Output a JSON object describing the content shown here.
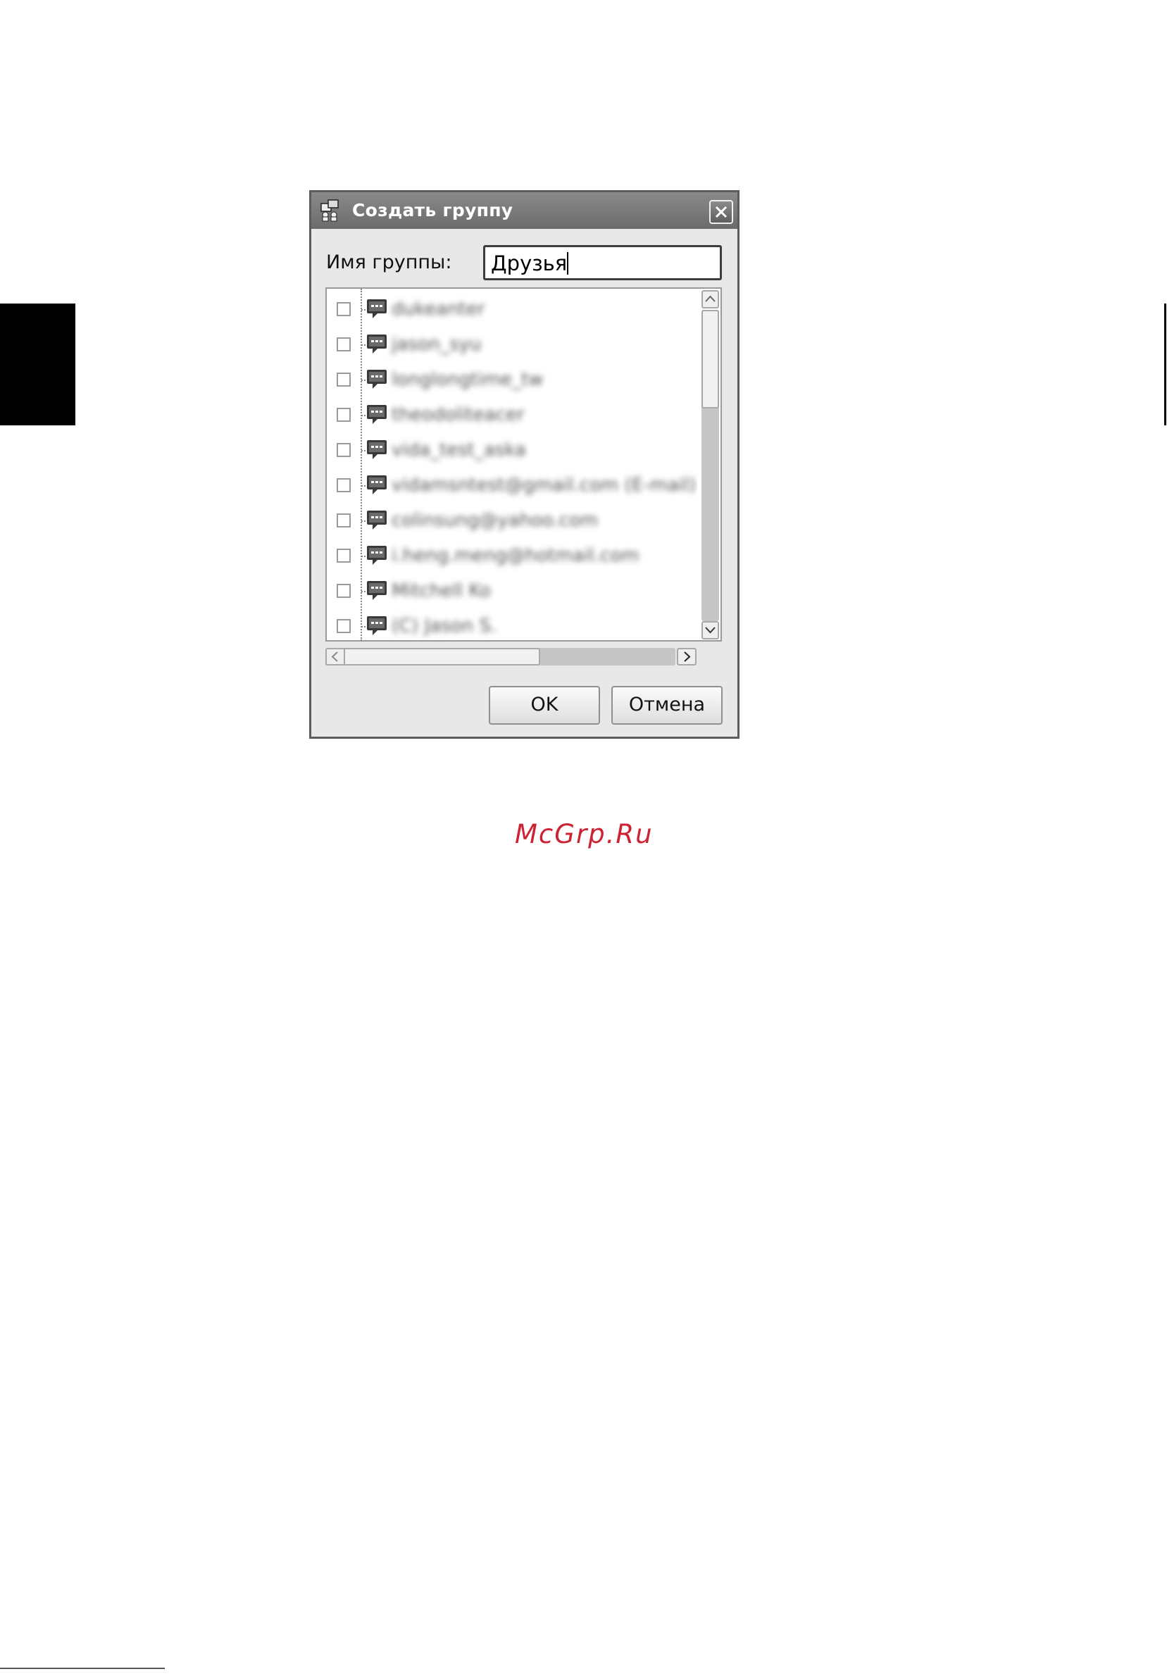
{
  "dialog": {
    "title": "Создать группу",
    "group_name_label": "Имя группы:",
    "group_name_value": "Друзья",
    "contacts": [
      "dukeanter",
      "jason_syu",
      "longlongtime_tw",
      "theodoliteacer",
      "vida_test_aska",
      "vidamsntest@gmail.com (E-mail)",
      "colinsung@yahoo.com",
      "i.heng.meng@hotmail.com",
      "Mitchell Ko",
      "(C) Jason S."
    ],
    "ok_label": "OK",
    "cancel_label": "Отмена"
  },
  "watermark": "McGrp.Ru",
  "colors": {
    "titlebar": "#7a7a7a",
    "watermark": "#cc2233",
    "dialog_bg": "#e8e8e8"
  },
  "icons": [
    "app-icon",
    "close-icon",
    "chat-bubble-icon",
    "arrow-up-icon",
    "arrow-down-icon",
    "arrow-left-icon",
    "arrow-right-icon"
  ]
}
